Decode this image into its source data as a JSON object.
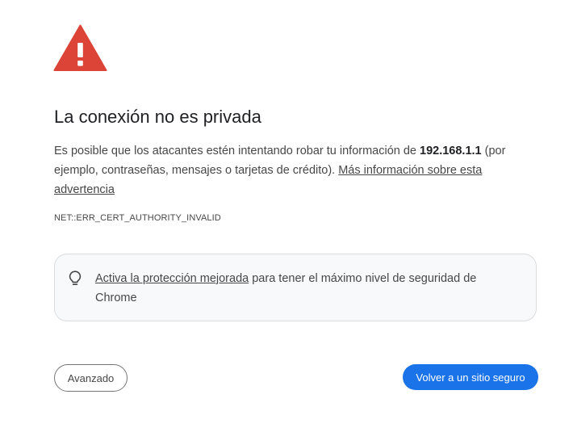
{
  "icons": {
    "warning": "warning-triangle-icon",
    "bulb": "lightbulb-icon"
  },
  "colors": {
    "warning_red": "#db4437",
    "primary_button": "#1a73e8",
    "card_background": "#f8f9fa"
  },
  "page": {
    "title": "La conexión no es privada",
    "explanation_prefix": "Es posible que los atacantes estén intentando robar tu información de ",
    "host": "192.168.1.1",
    "explanation_suffix": " (por ejemplo, contraseñas, mensajes o tarjetas de crédito). ",
    "learn_more_link": "Más información sobre esta advertencia",
    "error_code": "NET::ERR_CERT_AUTHORITY_INVALID"
  },
  "enhanced_protection": {
    "link_text": "Activa la protección mejorada",
    "text": " para tener el máximo nivel de seguridad de Chrome"
  },
  "buttons": {
    "advanced_label": "Avanzado",
    "back_to_safety_label": "Volver a un sitio seguro"
  }
}
